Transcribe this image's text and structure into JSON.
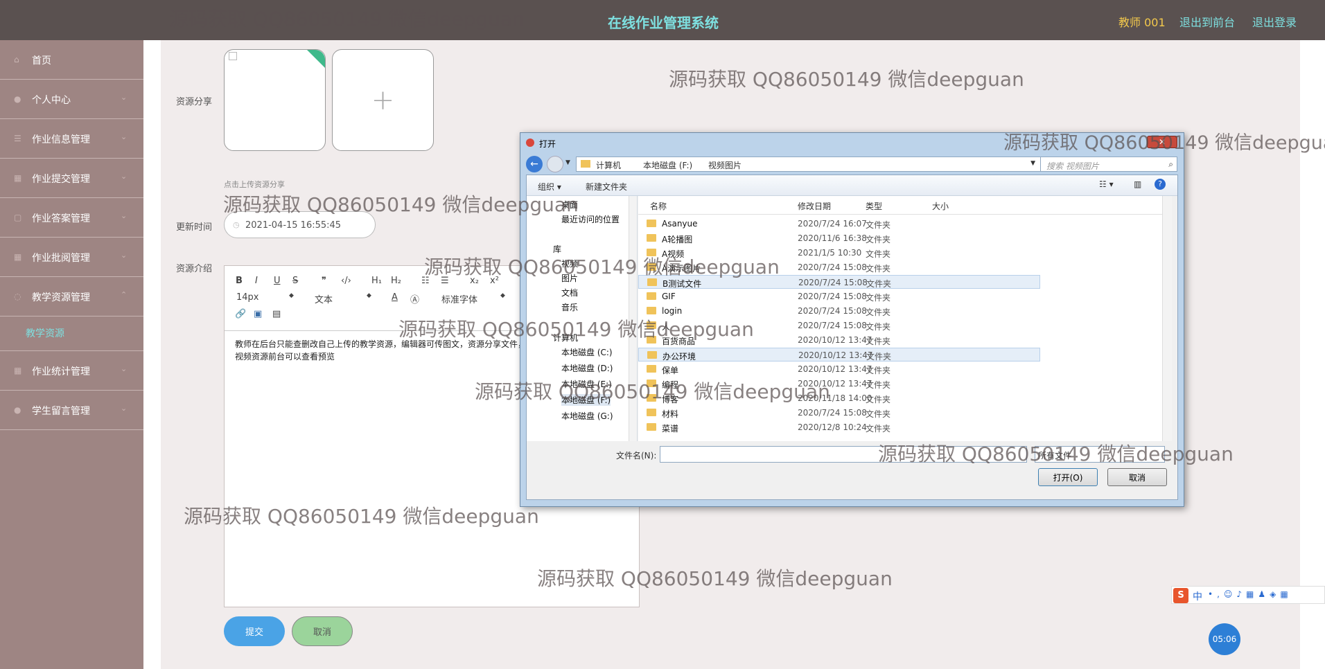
{
  "header": {
    "title": "在线作业管理系统",
    "user": "教师 001",
    "link_front": "退出到前台",
    "link_logout": "退出登录"
  },
  "sidebar": {
    "items": [
      {
        "label": "首页",
        "icon": "home-icon"
      },
      {
        "label": "个人中心",
        "icon": "person-icon"
      },
      {
        "label": "作业信息管理",
        "icon": "list-icon"
      },
      {
        "label": "作业提交管理",
        "icon": "list-icon"
      },
      {
        "label": "作业答案管理",
        "icon": "list-icon"
      },
      {
        "label": "作业批阅管理",
        "icon": "list-icon"
      },
      {
        "label": "教学资源管理",
        "icon": "list-icon"
      },
      {
        "label": "作业统计管理",
        "icon": "list-icon"
      },
      {
        "label": "学生留言管理",
        "icon": "list-icon"
      }
    ],
    "sub_item": "教学资源"
  },
  "form": {
    "resource_share_label": "资源分享",
    "upload_hint": "点击上传资源分享",
    "update_time_label": "更新时间",
    "update_time_value": "2021-04-15 16:55:45",
    "intro_label": "资源介绍",
    "editor_text": "教师在后台只能查删改自己上传的教学资源，编辑器可传图文，资源分享文件，视频资源前台可以查看预览",
    "font_size": "14px",
    "text_style": "文本",
    "font_family": "标准字体",
    "submit": "提交",
    "cancel": "取消"
  },
  "watermark": "源码获取 QQ86050149 微信deepguan",
  "dialog": {
    "title": "打开",
    "path": [
      "计算机",
      "本地磁盘 (F:)",
      "视频图片"
    ],
    "search_placeholder": "搜索 视频图片",
    "organize": "组织 ▾",
    "new_folder": "新建文件夹",
    "nav_items": [
      "桌面",
      "最近访问的位置",
      "库",
      "视频",
      "图片",
      "文档",
      "音乐",
      "计算机",
      "本地磁盘 (C:)",
      "本地磁盘 (D:)",
      "本地磁盘 (E:)",
      "本地磁盘 (F:)",
      "本地磁盘 (G:)"
    ],
    "columns": {
      "name": "名称",
      "date": "修改日期",
      "type": "类型",
      "size": "大小"
    },
    "files": [
      {
        "name": "Asanyue",
        "date": "2020/7/24 16:07",
        "type": "文件夹"
      },
      {
        "name": "A轮播图",
        "date": "2020/11/6 16:38",
        "type": "文件夹"
      },
      {
        "name": "A视频",
        "date": "2021/1/5 10:30",
        "type": "文件夹"
      },
      {
        "name": "A演示图片",
        "date": "2020/7/24 15:08",
        "type": "文件夹"
      },
      {
        "name": "B测试文件",
        "date": "2020/7/24 15:08",
        "type": "文件夹"
      },
      {
        "name": "GIF",
        "date": "2020/7/24 15:08",
        "type": "文件夹"
      },
      {
        "name": "login",
        "date": "2020/7/24 15:08",
        "type": "文件夹"
      },
      {
        "name": "人",
        "date": "2020/7/24 15:08",
        "type": "文件夹"
      },
      {
        "name": "百货商品",
        "date": "2020/10/12 13:47",
        "type": "文件夹"
      },
      {
        "name": "办公环境",
        "date": "2020/10/12 13:47",
        "type": "文件夹"
      },
      {
        "name": "保单",
        "date": "2020/10/12 13:47",
        "type": "文件夹"
      },
      {
        "name": "编程",
        "date": "2020/10/12 13:47",
        "type": "文件夹"
      },
      {
        "name": "博客",
        "date": "2020/11/18 14:00",
        "type": "文件夹"
      },
      {
        "name": "材料",
        "date": "2020/7/24 15:08",
        "type": "文件夹"
      },
      {
        "name": "菜谱",
        "date": "2020/12/8 10:24",
        "type": "文件夹"
      }
    ],
    "filename_label": "文件名(N):",
    "filetype": "所有文件",
    "open_button": "打开(O)",
    "cancel_button": "取消"
  },
  "ime": {
    "label": "中"
  },
  "timer": "05:06",
  "colors": {
    "topbar": "#5a5150",
    "sidebar": "#9e8583",
    "accent": "#7ee0e0",
    "user": "#f3c94c",
    "submit": "#4aa3e6",
    "cancel": "#9bd49b"
  }
}
